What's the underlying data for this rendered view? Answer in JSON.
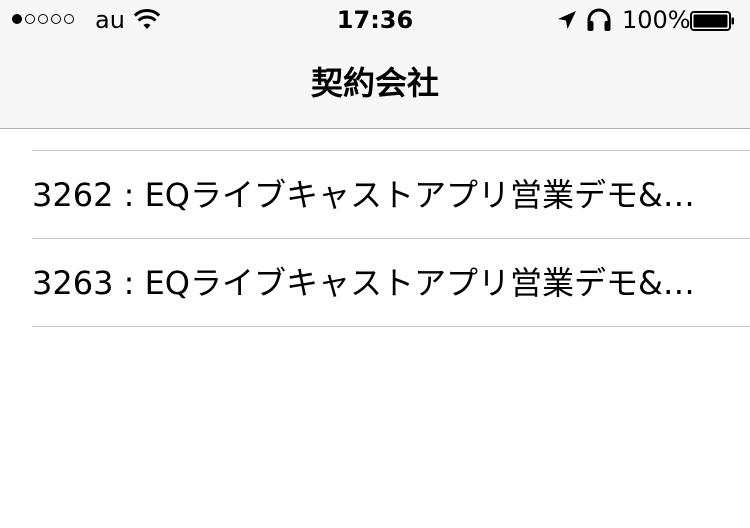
{
  "status_bar": {
    "carrier": "au",
    "time": "17:36",
    "battery": "100%",
    "signal_bars_filled": 1,
    "signal_bars_total": 5,
    "icons": [
      "wifi-icon",
      "location-arrow-icon",
      "headphones-icon",
      "battery-icon"
    ]
  },
  "nav": {
    "title": "契約会社"
  },
  "list": {
    "items": [
      {
        "label": "3262 : EQライブキャストアプリ営業デモ&…"
      },
      {
        "label": "3263 : EQライブキャストアプリ営業デモ&…"
      }
    ]
  },
  "colors": {
    "nav_background": "#f7f7f7",
    "separator": "#c8c7cc",
    "text": "#000000"
  }
}
